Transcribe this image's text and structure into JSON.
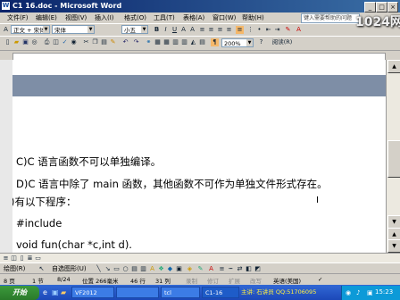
{
  "window": {
    "title": "C1 16.doc - Microsoft Word"
  },
  "menu": [
    "文件(F)",
    "编辑(E)",
    "视图(V)",
    "插入(I)",
    "格式(O)",
    "工具(T)",
    "表格(A)",
    "窗口(W)",
    "帮助(H)"
  ],
  "help_box": "键入需要帮助的问题",
  "toolbar": {
    "style": "正文 + 宋体",
    "font": "宋体",
    "size": "小五",
    "zoom": "200%",
    "read_label": "阅读(R)"
  },
  "document": {
    "lines": [
      "C)C 语言函数不可以单独编译。",
      "D)C 语言中除了 main 函数，其他函数不可作为单独文件形式存在。",
      ")有以下程序：",
      "#include ",
      "void fun(char *c,int d)."
    ]
  },
  "drawing_toolbar": {
    "draw": "绘图(R)",
    "autoshapes": "自选图形(U)"
  },
  "status": {
    "page": "8 页",
    "section": "1 节",
    "page_of": "8/24",
    "position": "位置 266毫米",
    "line": "46 行",
    "column": "31 列",
    "modes": [
      "录制",
      "修订",
      "扩展",
      "改写"
    ],
    "language": "英语(美国)"
  },
  "taskbar": {
    "start": "开始",
    "tasks": [
      "VF2012",
      "",
      "tcl",
      "C1-16"
    ],
    "ticker": "主讲: 石讲员 QQ:51706095",
    "clock": "15:23"
  },
  "watermark": "1024网"
}
